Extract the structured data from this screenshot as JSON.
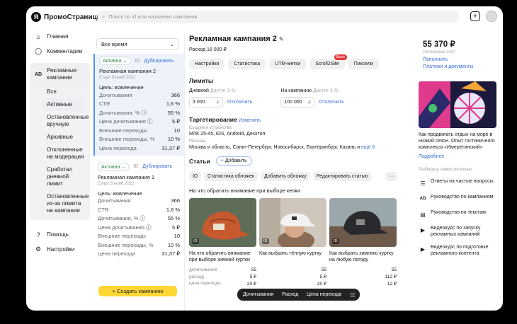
{
  "app": {
    "logo": "Я",
    "name": "ПромоСтраницы"
  },
  "search": {
    "placeholder": "Поиск по id или названию кампании"
  },
  "nav": [
    {
      "icon": "home-icon",
      "label": "Главная"
    },
    {
      "icon": "comment-icon",
      "label": "Комментарии"
    },
    {
      "icon": "ad-icon",
      "label": "Рекламные кампании"
    },
    {
      "icon": "help-icon",
      "label": "Помощь"
    },
    {
      "icon": "settings-icon",
      "label": "Настройки"
    }
  ],
  "filters": [
    "Все",
    "Активные",
    "Остановленные вручную",
    "Архивные",
    "Отклоненные на модерации",
    "Сработал дневной лимит",
    "Остановленные из-за лимита на кампании"
  ],
  "period": "Все время",
  "campaigns": [
    {
      "status": "Активна",
      "id": "ID",
      "dup": "Дублировать",
      "name": "Рекламная кампания 2",
      "start": "Старт 8 нояб 2022",
      "goal": "Цель: вовлечение",
      "metrics": [
        [
          "Дочитывания",
          "366"
        ],
        [
          "CTR",
          "1,6 %"
        ],
        [
          "Дочитывания, %",
          "55 %"
        ],
        [
          "Цена дочитывания",
          "5 ₽"
        ],
        [
          "Внешние переходы",
          "10"
        ],
        [
          "Внешние переходы, %",
          "10 %"
        ],
        [
          "Цена перехода",
          "31,37 ₽"
        ]
      ]
    },
    {
      "status": "Активна",
      "id": "ID",
      "dup": "Дублировать",
      "name": "Рекламная кампания 1",
      "start": "Старт 5 нояб 2022",
      "goal": "Цель: вовлечение",
      "metrics": [
        [
          "Дочитывания",
          "366"
        ],
        [
          "CTR",
          "1,6 %"
        ],
        [
          "Дочитывания, %",
          "55 %"
        ],
        [
          "Цена дочитывания",
          "5 ₽"
        ],
        [
          "Внешние переходы",
          "10"
        ],
        [
          "Внешние переходы, %",
          "10 %"
        ],
        [
          "Цена перехода",
          "31,37 ₽"
        ]
      ]
    }
  ],
  "create_btn": "+ Создать кампанию",
  "main": {
    "title": "Рекламная кампания 2",
    "cost": "Расход 18 000 ₽",
    "tabs": [
      "Настройки",
      "Статистика",
      "UTM-метки",
      "Scroll2Site",
      "Пиксели"
    ],
    "badge": "Выкл",
    "limits_h": "Лимиты",
    "daily_lbl": "Дневной",
    "daily_hint": "Достиг 3 %",
    "daily_val": "3 000",
    "camp_lbl": "На кампанию",
    "camp_hint": "Достиг 3 %",
    "camp_val": "100 000",
    "currency": "₽",
    "disable": "Отключить",
    "target_h": "Таргетирование",
    "change": "Изменить",
    "sd_lbl": "Соцдем и устройства",
    "sd_val": "М/Ж 25-45, iOS, Android, Десктоп",
    "reg_lbl": "Регионы",
    "reg_val": "Москва и область, Санкт-Петербург, Новосибирск, Екатеринбург, Казань и",
    "reg_more": "еще 6",
    "art_h": "Статьи",
    "add": "Добавить",
    "tools": [
      "ID",
      "Статистика обложек",
      "Добавить обложку",
      "Редактировать статью"
    ],
    "question": "На что обратить внимание при выборе кепки",
    "articles": [
      {
        "caption": "На что обратить внимание при выборе зимней куртки",
        "stats": [
          [
            "дочитывания",
            "55"
          ],
          [
            "расход",
            "5 ₽"
          ],
          [
            "цена перехода",
            "20 ₽"
          ]
        ]
      },
      {
        "caption": "Как выбрать тёплую куртку",
        "stats": [
          [
            "",
            "55"
          ],
          [
            "",
            "5 ₽"
          ],
          [
            "",
            "20 ₽"
          ]
        ]
      },
      {
        "caption": "Как выбрать зимнюю куртку на любую погоду",
        "stats": [
          [
            "",
            "55"
          ],
          [
            "",
            "112 ₽"
          ],
          [
            "",
            "12 ₽"
          ]
        ]
      }
    ],
    "id_tag": "ID",
    "pill": [
      "Дочитывания",
      "Расход",
      "Цена перехода"
    ]
  },
  "right": {
    "balance": "55 370 ₽",
    "balance_lbl": "Рекламный счёт",
    "links": [
      "Пополнить",
      "Платежи и документы"
    ],
    "promo_text": "Как продвигать отдых на море в низкий сезон. Опыт гостиничного комплекса «Имеретинский»",
    "promo_link": "Подробнее",
    "self_h": "Разберусь самостоятельно",
    "self": [
      {
        "icon": "list-icon",
        "label": "Ответы на частые вопросы"
      },
      {
        "icon": "ad-icon",
        "label": "Руководство по кампаниям"
      },
      {
        "icon": "doc-icon",
        "label": "Руководство по текстам"
      },
      {
        "icon": "play-icon",
        "label": "Видеокурс по запуску рекламных кампаний"
      },
      {
        "icon": "play-icon",
        "label": "Видеокурс по подготовке рекламного контента"
      }
    ]
  }
}
